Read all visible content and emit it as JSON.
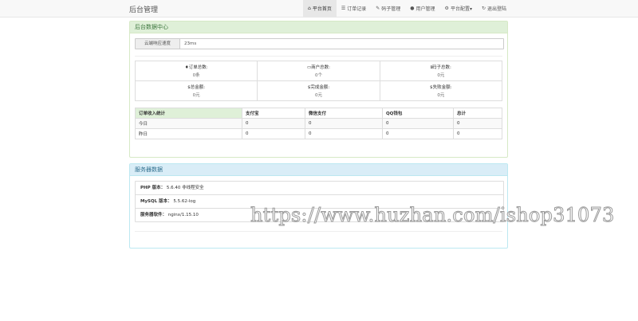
{
  "navbar": {
    "brand": "后台管理",
    "items": [
      {
        "icon": "home-icon",
        "glyph": "⌂",
        "label": "平台首页",
        "active": true
      },
      {
        "icon": "list-icon",
        "glyph": "☰",
        "label": "订单记录",
        "active": false
      },
      {
        "icon": "edit-icon",
        "glyph": "✎",
        "label": "码子管理",
        "active": false
      },
      {
        "icon": "user-icon",
        "glyph": "👤",
        "label": "用户管理",
        "active": false
      },
      {
        "icon": "gear-icon",
        "glyph": "⚙",
        "label": "平台配置▾",
        "active": false
      },
      {
        "icon": "logout-icon",
        "glyph": "↻",
        "label": "退出登陆",
        "active": false
      }
    ]
  },
  "data_panel": {
    "title": "后台数据中心",
    "speed_label": "云端响应速度",
    "speed_value": "23ms",
    "stats": [
      {
        "icon": "tint-icon",
        "glyph": "💧",
        "label": "订单总数:",
        "value": "0条"
      },
      {
        "icon": "credit-card-icon",
        "glyph": "▭",
        "label": "商户总数:",
        "value": "0个"
      },
      {
        "icon": "info-icon",
        "glyph": "ℹ",
        "label": "码子总数:",
        "value": "0元"
      },
      {
        "icon": "dollar-icon",
        "glyph": "$",
        "label": "总金额:",
        "value": "0元"
      },
      {
        "icon": "dollar-icon",
        "glyph": "$",
        "label": "完成金额:",
        "value": "0元"
      },
      {
        "icon": "dollar-icon",
        "glyph": "$",
        "label": "失败金额:",
        "value": "0元"
      }
    ],
    "revenue_table": {
      "headers": [
        "订单收入统计",
        "支付宝",
        "微信支付",
        "QQ钱包",
        "总计"
      ],
      "rows": [
        [
          "今日",
          "0",
          "0",
          "0",
          "0"
        ],
        [
          "昨日",
          "0",
          "0",
          "0",
          "0"
        ]
      ]
    }
  },
  "server_panel": {
    "title": "服务器数据",
    "rows": [
      {
        "label": "PHP 版本：",
        "value": "5.6.40 非线程安全"
      },
      {
        "label": "MySQL 版本：",
        "value": "5.5.62-log"
      },
      {
        "label": "服务器软件：",
        "value": "nginx/1.15.10"
      }
    ]
  },
  "watermark": "https://www.huzhan.com/ishop31073"
}
